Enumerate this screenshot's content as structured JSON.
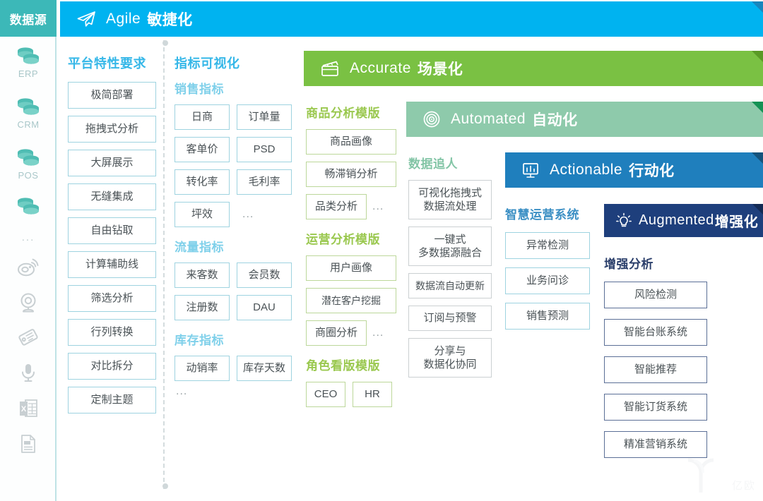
{
  "sidebar": {
    "header": "数据源",
    "items": [
      {
        "icon": "database-icon",
        "label": "ERP"
      },
      {
        "icon": "database-icon",
        "label": "CRM"
      },
      {
        "icon": "database-icon",
        "label": "POS"
      },
      {
        "icon": "database-icon",
        "label": ""
      },
      {
        "icon": "ellipsis-icon",
        "label": "..."
      },
      {
        "icon": "weibo-icon",
        "label": ""
      },
      {
        "icon": "webcam-icon",
        "label": ""
      },
      {
        "icon": "tag-icon",
        "label": ""
      },
      {
        "icon": "microphone-icon",
        "label": ""
      },
      {
        "icon": "excel-file-icon",
        "label": ""
      },
      {
        "icon": "document-file-icon",
        "label": ""
      }
    ]
  },
  "banners": [
    {
      "icon": "paper-plane-icon",
      "en": "Agile",
      "cn": "敏捷化",
      "color": "#00b3f0",
      "fold": "#1886bd"
    },
    {
      "icon": "clapperboard-icon",
      "en": "Accurate",
      "cn": "场景化",
      "color": "#7ac143",
      "fold": "#5a9a26"
    },
    {
      "icon": "radar-icon",
      "en": "Automated",
      "cn": "自动化",
      "color": "#8ecaab",
      "fold": "#149255"
    },
    {
      "icon": "dashboard-icon",
      "en": "Actionable",
      "cn": "行动化",
      "color": "#1f7fbd",
      "fold": "#15537c"
    },
    {
      "icon": "lightbulb-icon",
      "en": "Augmented",
      "cn": "增强化",
      "color": "#1e3f7c",
      "fold": "#132a54"
    }
  ],
  "columns": {
    "platform": {
      "title": "平台特性要求",
      "items": [
        "极简部署",
        "拖拽式分析",
        "大屏展示",
        "无缝集成",
        "自由钻取",
        "计算辅助线",
        "筛选分析",
        "行列转换",
        "对比拆分",
        "定制主题"
      ]
    },
    "metrics": {
      "title": "指标可视化",
      "groups": [
        {
          "title": "销售指标",
          "items": [
            "日商",
            "订单量",
            "客单价",
            "PSD",
            "转化率",
            "毛利率",
            "坪效"
          ],
          "trailing_ellipsis": true
        },
        {
          "title": "流量指标",
          "items": [
            "来客数",
            "会员数",
            "注册数",
            "DAU"
          ],
          "trailing_ellipsis": false
        },
        {
          "title": "库存指标",
          "items": [
            "动销率",
            "库存天数"
          ],
          "trailing_ellipsis": false
        }
      ],
      "footer_ellipsis": "..."
    },
    "templates": {
      "groups": [
        {
          "title": "商品分析模版",
          "items": [
            "商品画像",
            "畅滞销分析",
            "品类分析"
          ],
          "trailing_ellipsis": "..."
        },
        {
          "title": "运营分析模版",
          "items": [
            "用户画像",
            "潜在客户挖掘",
            "商圈分析"
          ],
          "trailing_ellipsis": "..."
        },
        {
          "title": "角色看版模版",
          "items": [
            "CEO",
            "HR"
          ],
          "trailing_ellipsis": ""
        }
      ]
    },
    "data_flow": {
      "title": "数据追人",
      "items": [
        [
          "可视化拖拽式",
          "数据流处理"
        ],
        [
          "一键式",
          "多数据源融合"
        ],
        [
          "数据流自动更新"
        ],
        [
          "订阅与预警"
        ],
        [
          "分享与",
          "数据化协同"
        ]
      ]
    },
    "smart_ops": {
      "title": "智慧运营系统",
      "items": [
        "异常检测",
        "业务问诊",
        "销售预测"
      ]
    },
    "augmented": {
      "title": "增强分析",
      "items": [
        "风险检测",
        "智能台账系统",
        "智能推荐",
        "智能订货系统",
        "精准营销系统"
      ]
    }
  },
  "watermark": {
    "text": "亿欧"
  }
}
